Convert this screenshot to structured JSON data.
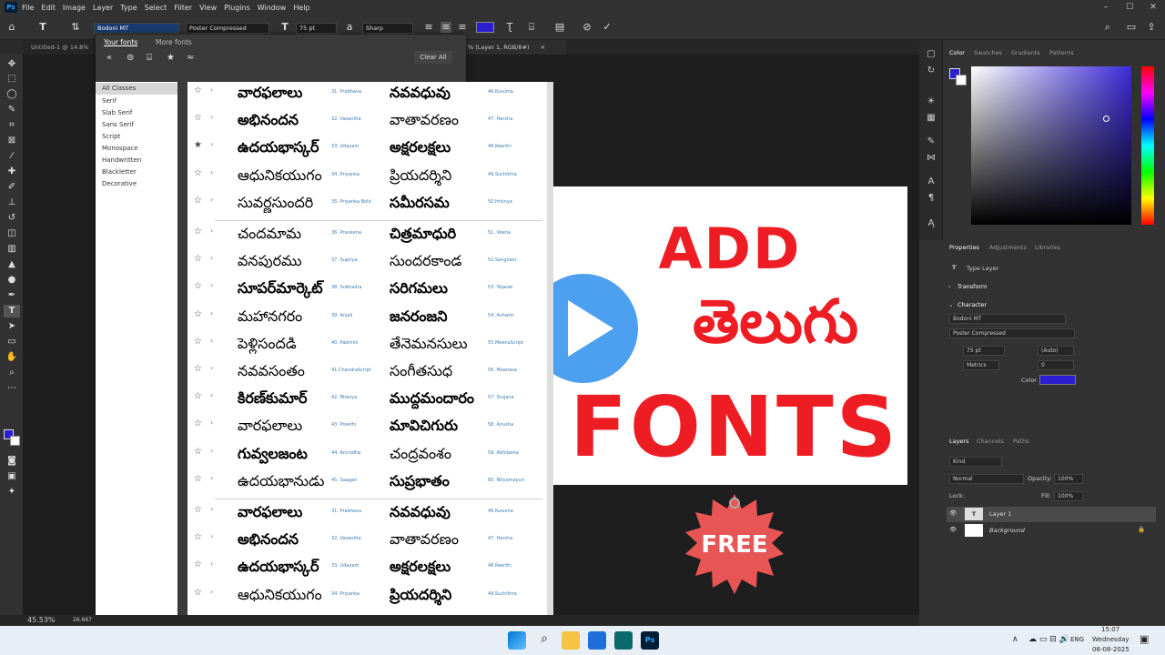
{
  "app": {
    "name": "Ps",
    "menus": [
      "File",
      "Edit",
      "Image",
      "Layer",
      "Type",
      "Select",
      "Filter",
      "View",
      "Plugins",
      "Window",
      "Help"
    ]
  },
  "options": {
    "font_family": "Bodoni MT",
    "font_style": "Poster Compressed",
    "font_size": "75 pt",
    "antialias": "Sharp",
    "text_color": "#2b1fd0"
  },
  "doc": {
    "tab1": "Untitled-1 @ 14.8%",
    "tab2": "% (Layer 1, RGB/8#)",
    "tab2_close": "×"
  },
  "font_panel": {
    "tabs": [
      "Your fonts",
      "More fonts"
    ],
    "clear_all": "Clear All",
    "classes": [
      "All Classes",
      "Serif",
      "Slab Serif",
      "Sans Serif",
      "Script",
      "Monospace",
      "Handwritten",
      "Blackletter",
      "Decorative"
    ],
    "rows": [
      {
        "a": "వారఫలాలు",
        "an": "31. Prabhava",
        "b": "నవవధువు",
        "bn": "46.Kusuma",
        "star": "☆"
      },
      {
        "a": "అభినందన",
        "an": "32. Vasantha",
        "b": "వాతావరణం",
        "bn": "47. Harsha",
        "star": "☆"
      },
      {
        "a": "ఉదయభాస్కర్",
        "an": "33. Udayam",
        "b": "అక్షరలక్షలు",
        "bn": "48.Keerthi",
        "star": "★"
      },
      {
        "a": "ఆధునికయుగం",
        "an": "34. Priyanka",
        "b": "ప్రియదర్శిని",
        "bn": "49.Suchithra",
        "star": "☆"
      },
      {
        "a": "సువర్ణసుందరి",
        "an": "35. Priyanka Bold",
        "b": "సమీరసమ",
        "bn": "50.Hrisnya",
        "star": "☆"
      },
      {
        "a": "చందమామ",
        "an": "36. Praveena",
        "b": "చిత్రమాధురి",
        "bn": "51. Veena",
        "star": "☆"
      },
      {
        "a": "వనపురము",
        "an": "37. Supriya",
        "b": "సుందరకాండ",
        "bn": "52.Sanghavi",
        "star": "☆"
      },
      {
        "a": "సూపర్‌మార్కెట్",
        "an": "38. Subhadra",
        "b": "సరిగమలు",
        "bn": "53. Tejaswi",
        "star": "☆"
      },
      {
        "a": "మహానగరం",
        "an": "39. Anjali",
        "b": "జనరంజని",
        "bn": "54. Ashwini",
        "star": "☆"
      },
      {
        "a": "పెళ్లిసందడి",
        "an": "40. Padmini",
        "b": "తేనెమనసులు",
        "bn": "55.MeenaScript",
        "star": "☆"
      },
      {
        "a": "నవవసంతం",
        "an": "41.ChandraScript",
        "b": "సంగీతసుధ",
        "bn": "56. Maanasa",
        "star": "☆"
      },
      {
        "a": "కిరణ్‌కుమార్",
        "an": "42. Bhavya",
        "b": "ముద్దమందారం",
        "bn": "57. Srujana",
        "star": "☆"
      },
      {
        "a": "వారఫలాలు",
        "an": "43. Preethi",
        "b": "మావిచిగురు",
        "bn": "58. Anusha",
        "star": "☆"
      },
      {
        "a": "గువ్వలజంట",
        "an": "44. Anirudha",
        "b": "చంద్రవంశం",
        "bn": "59. Abhilasha",
        "star": "☆"
      },
      {
        "a": "ఉదయభానుడు",
        "an": "45. Saagari",
        "b": "సుప్రభాతం",
        "bn": "60. Nityamayuri",
        "star": "☆"
      },
      {
        "a": "వారఫలాలు",
        "an": "31. Prabhava",
        "b": "నవవధువు",
        "bn": "46.Kusuma",
        "star": "☆"
      },
      {
        "a": "అభినందన",
        "an": "32. Vasantha",
        "b": "వాతావరణం",
        "bn": "47. Harsha",
        "star": "☆"
      },
      {
        "a": "ఉదయభాస్కర్",
        "an": "33. Udayam",
        "b": "అక్షరలక్షలు",
        "bn": "48.Keerthi",
        "star": "☆"
      },
      {
        "a": "ఆధునికయుగం",
        "an": "34. Priyanka",
        "b": "ప్రియదర్శిని",
        "bn": "49.Suchithra",
        "star": "☆"
      }
    ]
  },
  "artwork": {
    "add": "ADD",
    "telugu": "తెలుగు",
    "fonts": "FONTS",
    "free": "FREE"
  },
  "right": {
    "tabs1": [
      "Color",
      "Swatches",
      "Gradients",
      "Patterns"
    ],
    "tabs2": [
      "Properties",
      "Adjustments",
      "Libraries"
    ],
    "type_layer": "Type Layer",
    "transform": "Transform",
    "character": "Character",
    "char_font": "Bodoni MT",
    "char_style": "Poster Compressed",
    "char_size": "75 pt",
    "char_leading": "(Auto)",
    "char_kerning": "Metrics",
    "char_tracking": "0",
    "color_label": "Color",
    "tabs3": [
      "Layers",
      "Channels",
      "Paths"
    ],
    "kind": "Kind",
    "blend": "Normal",
    "opacity_label": "Opacity:",
    "opacity": "100%",
    "lock_label": "Lock:",
    "fill_label": "Fill:",
    "fill": "100%",
    "layers": [
      "Layer 1",
      "Background"
    ]
  },
  "status": {
    "zoom": "45.53%",
    "zoom2": "26.667"
  },
  "taskbar": {
    "lang": "ENG",
    "time": "15:07",
    "day": "Wednesday",
    "date": "06-08-2025"
  }
}
